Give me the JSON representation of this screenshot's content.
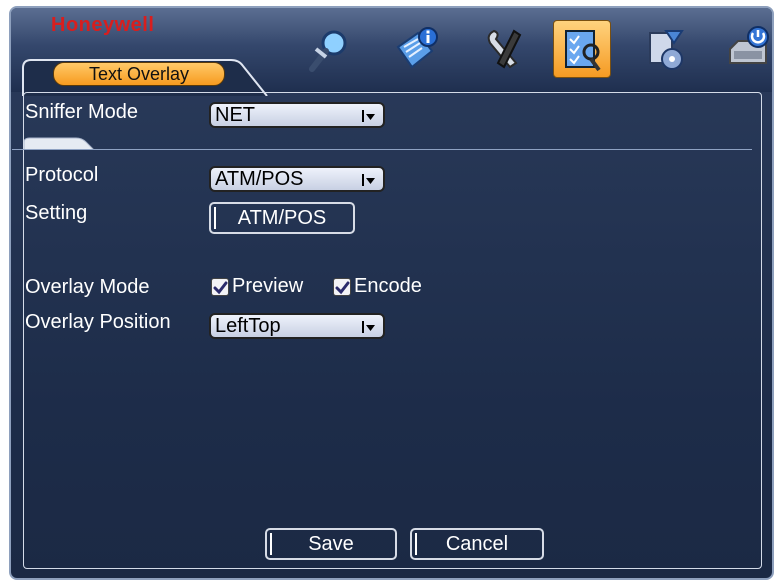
{
  "header": {
    "brand": "Honeywell",
    "tab_label": "Text Overlay",
    "icons": [
      "search-icon",
      "info-icon",
      "tools-icon",
      "config-icon",
      "backup-icon",
      "shutdown-icon"
    ],
    "active_icon": "config-icon"
  },
  "form": {
    "sniffer_mode": {
      "label": "Sniffer Mode",
      "value": "NET"
    },
    "protocol": {
      "label": "Protocol",
      "value": "ATM/POS"
    },
    "setting": {
      "label": "Setting",
      "button": "ATM/POS"
    },
    "overlay_mode": {
      "label": "Overlay Mode",
      "preview": "Preview",
      "encode": "Encode",
      "preview_checked": true,
      "encode_checked": true
    },
    "overlay_position": {
      "label": "Overlay Position",
      "value": "LeftTop"
    }
  },
  "footer": {
    "save": "Save",
    "cancel": "Cancel"
  },
  "colors": {
    "background": "#1d2c49",
    "accent": "#f79b1f",
    "brand": "#d81e1e"
  }
}
